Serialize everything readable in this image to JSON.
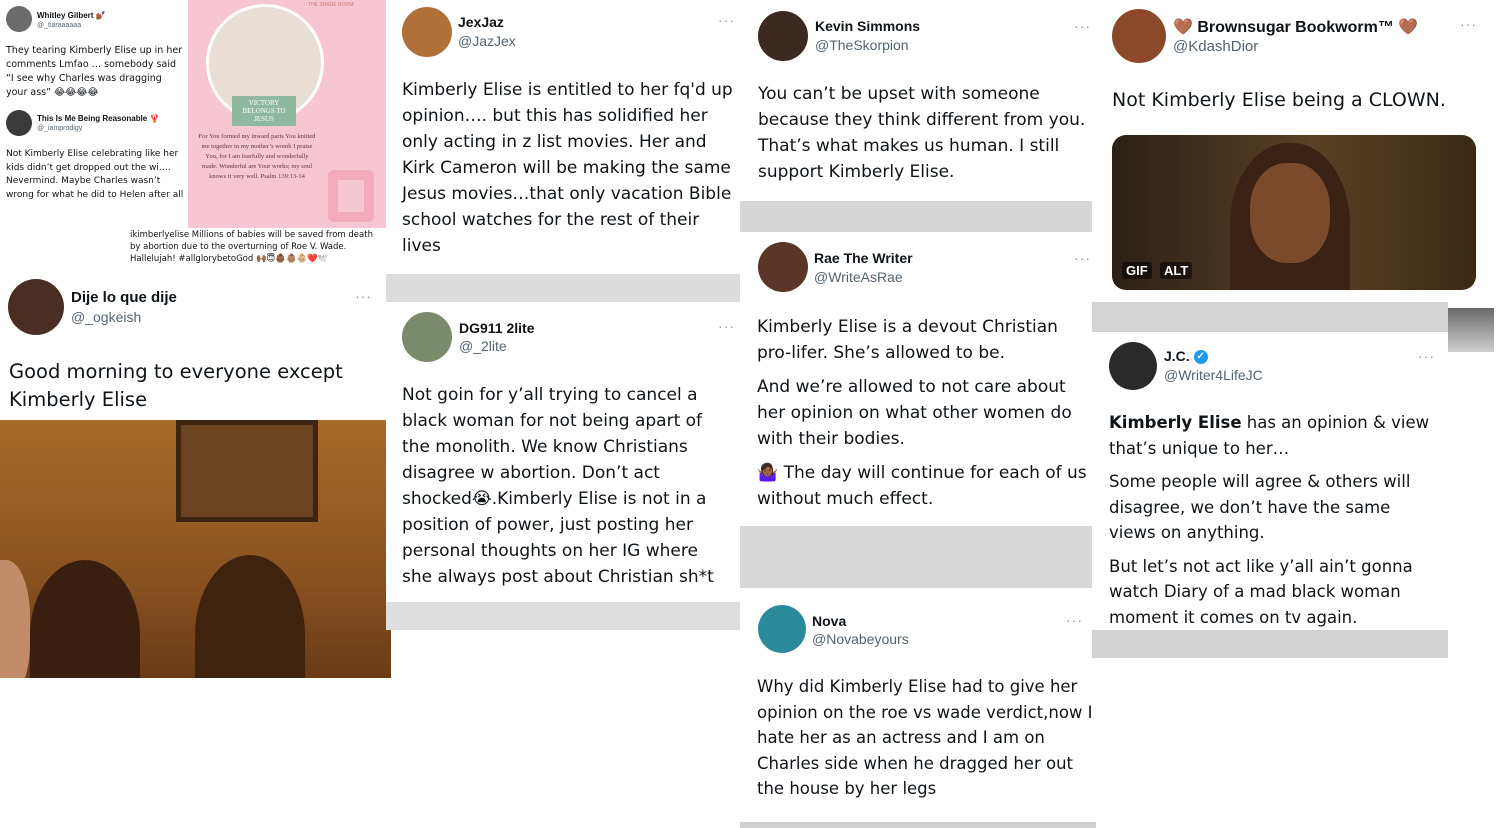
{
  "collage": {
    "top_left": {
      "tweet1": {
        "name": "Whitley Gilbert 💅🏾",
        "handle": "@_tiaraaaaaa",
        "text": "They tearing Kimberly Elise up in her comments Lmfao … somebody said “I see why Charles was dragging your ass” 😂😂😂😂"
      },
      "tweet2": {
        "name": "This Is Me Being Reasonable 🦞",
        "handle": "@_iamprodigy",
        "text": "Not Kimberly Elise celebrating like her kids didn’t get dropped out the wi…. Nevermind. Maybe Charles wasn’t wrong for what he did to Helen after all"
      },
      "poster": {
        "banner": "VICTORY BELONGS TO JESUS",
        "verse": "For You formed my inward parts You knitted me together in my mother’s womb I praise You, for I am fearfully and wonderfully made. Wonderful are Your works; my soul knows it very well. Psalm 139:13-14",
        "watermark": "THE SHADE ROOM"
      },
      "ig_caption": "ikimberlyelise Millions of babies will be saved from death by abortion due to the overturning of Roe V. Wade. Hallelujah! #allglorybetoGod 🙌🏾😇👶🏾👶🏽👶🏼❤️🕊️"
    },
    "tweets": {
      "ogkeish": {
        "name": "Dije lo que dije",
        "handle": "@_ogkeish",
        "more": "···",
        "text": "Good morning to everyone except Kimberly Elise"
      },
      "jazjex": {
        "name": "JexJaz",
        "handle": "@JazJex",
        "more": "···",
        "text": "Kimberly Elise is entitled to her fq'd up opinion…. but this has solidified her only acting in z list movies. Her and Kirk Cameron will be making the same Jesus movies…that only vacation Bible school watches for the rest of their lives"
      },
      "dg911": {
        "name": "DG911 2lite",
        "handle": "@_2lite",
        "more": "···",
        "text": "Not goin for y’all trying to cancel a black woman for not being apart of the monolith. We know Christians disagree w abortion. Don’t act shocked😭.Kimberly Elise is not in a position of power, just posting her personal thoughts on her IG where she always post about Christian sh*t"
      },
      "skorpion": {
        "name": "Kevin Simmons",
        "handle": "@TheSkorpion",
        "more": "···",
        "text": "You can’t be upset with someone because they think different from you. That’s what makes us human. I still support Kimberly Elise."
      },
      "rae": {
        "name": "Rae The Writer",
        "handle": "@WriteAsRae",
        "more": "···",
        "p1": "Kimberly Elise is a devout Christian pro-lifer. She’s allowed to be.",
        "p2": "And we’re allowed to not care about her opinion on what other women do with their bodies.",
        "p3": "🤷🏾‍♀️ The day will continue for each of us without much effect."
      },
      "nova": {
        "name": "Nova",
        "handle": "@Novabeyours",
        "more": "···",
        "text": "Why did Kimberly Elise had to give her opinion on the roe vs wade verdict,now I hate her as an actress and I am on Charles side when he dragged her out the house by her legs"
      },
      "kdash": {
        "name": "🤎 Brownsugar Bookworm™ 🤎",
        "handle": "@KdashDior",
        "more": "···",
        "text": "Not Kimberly Elise being a CLOWN.",
        "gif_label": "GIF",
        "alt_label": "ALT"
      },
      "jc": {
        "name": "J.C.",
        "verified": "✓",
        "handle": "@Writer4LifeJC",
        "more": "···",
        "bold": "Kimberly Elise",
        "p1_rest": " has an opinion & view that’s unique to her…",
        "p2": "Some people will agree & others will disagree, we don’t have the same views on anything.",
        "p3": "But let’s not act like y’all ain’t gonna watch Diary of a mad black woman moment it comes on tv again."
      }
    }
  },
  "colors": {
    "text": "#0f1419",
    "handle": "#536471",
    "verified": "#1d9bf0",
    "separator": "#d4d4d4"
  }
}
